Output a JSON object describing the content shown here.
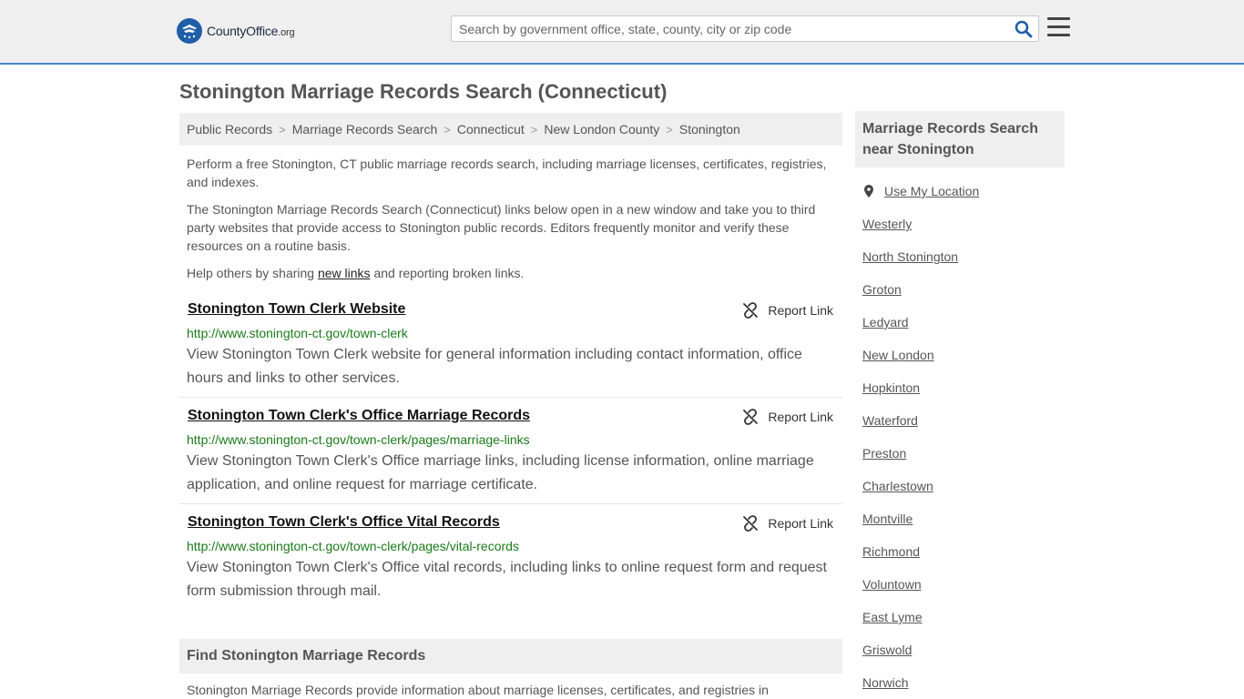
{
  "header": {
    "logo_name": "CountyOffice",
    "logo_tld": ".org",
    "search_placeholder": "Search by government office, state, county, city or zip code",
    "brand_color": "#1f5fa8",
    "accent_line": "#4a88c5"
  },
  "page_title": "Stonington Marriage Records Search (Connecticut)",
  "breadcrumb": [
    "Public Records",
    "Marriage Records Search",
    "Connecticut",
    "New London County",
    "Stonington"
  ],
  "intro": {
    "p1": "Perform a free Stonington, CT public marriage records search, including marriage licenses, certificates, registries, and indexes.",
    "p2": "The Stonington Marriage Records Search (Connecticut) links below open in a new window and take you to third party websites that provide access to Stonington public records. Editors frequently monitor and verify these resources on a routine basis.",
    "p3_before": "Help others by sharing ",
    "p3_link": "new links",
    "p3_after": " and reporting broken links."
  },
  "results": [
    {
      "title": "Stonington Town Clerk Website",
      "url": "http://www.stonington-ct.gov/town-clerk",
      "description": "View Stonington Town Clerk website for general information including contact information, office hours and links to other services.",
      "report": "Report Link"
    },
    {
      "title": "Stonington Town Clerk's Office Marriage Records",
      "url": "http://www.stonington-ct.gov/town-clerk/pages/marriage-links",
      "description": "View Stonington Town Clerk's Office marriage links, including license information, online marriage application, and online request for marriage certificate.",
      "report": "Report Link"
    },
    {
      "title": "Stonington Town Clerk's Office Vital Records",
      "url": "http://www.stonington-ct.gov/town-clerk/pages/vital-records",
      "description": "View Stonington Town Clerk's Office vital records, including links to online request form and request form submission through mail.",
      "report": "Report Link"
    }
  ],
  "find_heading": "Find Stonington Marriage Records",
  "bottom_text": "Stonington Marriage Records provide information about marriage licenses, certificates, and registries in",
  "sidebar": {
    "heading_line1": "Marriage Records Search",
    "heading_line2": "near Stonington",
    "use_location": "Use My Location",
    "places": [
      "Westerly",
      "North Stonington",
      "Groton",
      "Ledyard",
      "New London",
      "Hopkinton",
      "Waterford",
      "Preston",
      "Charlestown",
      "Montville",
      "Richmond",
      "Voluntown",
      "East Lyme",
      "Griswold",
      "Norwich"
    ]
  }
}
